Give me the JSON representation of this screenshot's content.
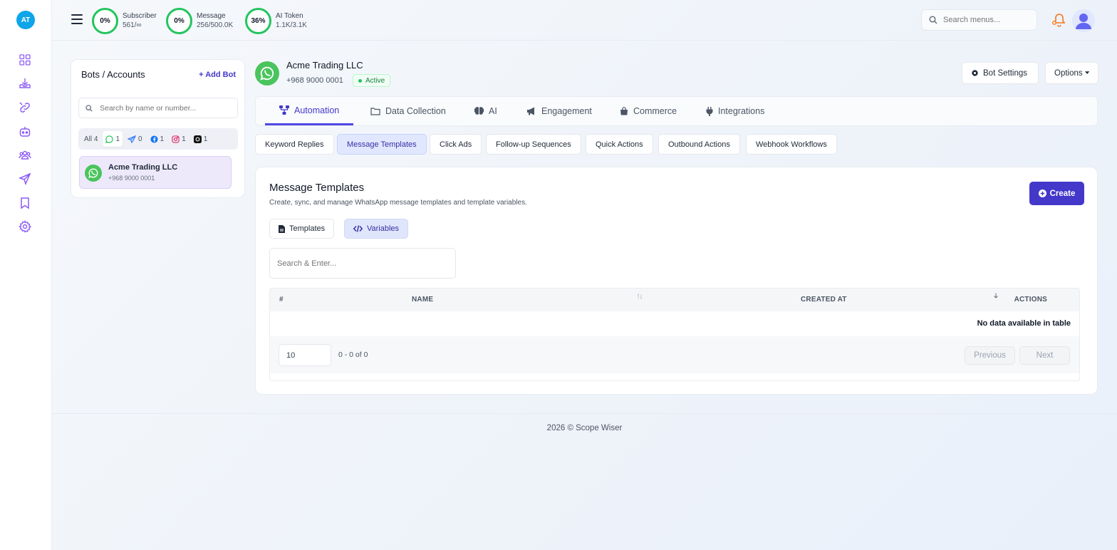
{
  "user": {
    "initials": "AT"
  },
  "sidebar": {
    "icons": [
      "dashboard-icon",
      "inbox-download-icon",
      "link-icon",
      "bot-icon",
      "users-icon",
      "send-icon",
      "bookmark-icon",
      "settings-icon"
    ]
  },
  "stats": [
    {
      "percent": "0%",
      "label": "Subscriber",
      "value": "561/∞"
    },
    {
      "percent": "0%",
      "label": "Message",
      "value": "256/500.0K"
    },
    {
      "percent": "36%",
      "label": "AI Token",
      "value": "1.1K/3.1K"
    }
  ],
  "topbar": {
    "search_placeholder": "Search menus..."
  },
  "bots_panel": {
    "title": "Bots / Accounts",
    "add_label": "+ Add Bot",
    "search_placeholder": "Search by name or number...",
    "filters": {
      "all": "All 4",
      "whatsapp": "1",
      "telegram": "0",
      "facebook": "1",
      "instagram": "1",
      "threads": "1"
    },
    "items": [
      {
        "name": "Acme Trading LLC",
        "number": "+968 9000 0001"
      }
    ]
  },
  "bot": {
    "name": "Acme Trading LLC",
    "number": "+968 9000 0001",
    "status": "Active",
    "settings_label": "Bot Settings",
    "options_label": "Options"
  },
  "main_tabs": [
    "Automation",
    "Data Collection",
    "AI",
    "Engagement",
    "Commerce",
    "Integrations"
  ],
  "sub_tabs": [
    "Keyword Replies",
    "Message Templates",
    "Click Ads",
    "Follow-up Sequences",
    "Quick Actions",
    "Outbound Actions",
    "Webhook Workflows"
  ],
  "card": {
    "title": "Message Templates",
    "subtitle": "Create, sync, and manage WhatsApp message templates and template variables.",
    "create_label": "Create",
    "seg_templates": "Templates",
    "seg_variables": "Variables",
    "search_placeholder": "Search & Enter...",
    "table": {
      "headers": [
        "#",
        "NAME",
        "CREATED AT",
        "ACTIONS"
      ],
      "empty": "No data available in table",
      "page_size": "10",
      "range": "0 - 0 of 0",
      "prev": "Previous",
      "next": "Next"
    }
  },
  "footer": {
    "text": "2026 © Scope Wiser"
  },
  "colors": {
    "accent": "#4338ca",
    "whatsapp": "#4ac45c",
    "ring": "#22c55e"
  }
}
